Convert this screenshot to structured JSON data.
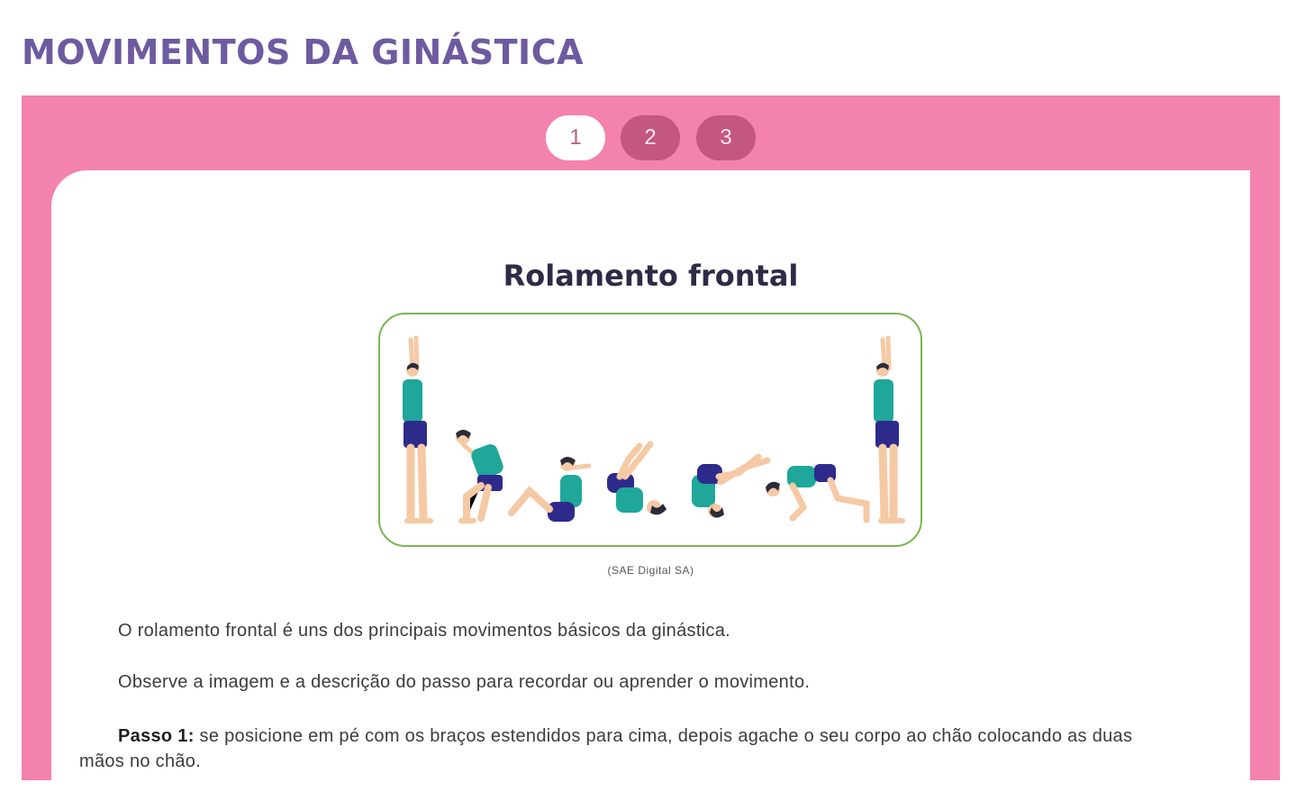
{
  "page": {
    "title": "MOVIMENTOS DA GINÁSTICA"
  },
  "pagination": {
    "pages": [
      "1",
      "2",
      "3"
    ],
    "active": "1"
  },
  "section": {
    "title": "Rolamento frontal",
    "image_credit": "(SAE Digital SA)",
    "paragraphs": [
      "O rolamento frontal é uns dos principais movimentos básicos da ginástica.",
      "Observe a imagem e a descrição do passo para recordar ou aprender o movimento."
    ],
    "step1": {
      "label": "Passo 1:",
      "text": " se posicione em pé com os braços estendidos para cima, depois agache o seu corpo ao chão colocando as duas mãos no chão."
    }
  },
  "colors": {
    "title": "#6e5aa0",
    "frame": "#f382ae",
    "pagination_inactive": "#c4577f",
    "image_border": "#7cb554",
    "figure_shirt": "#1fa79a",
    "figure_shorts": "#2e2a8c",
    "figure_skin": "#f5c9a4",
    "figure_hair": "#2b2b3a"
  }
}
